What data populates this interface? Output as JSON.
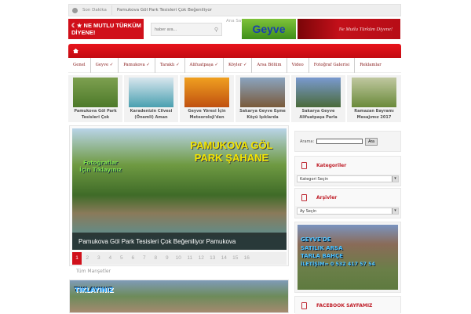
{
  "topbar": {
    "label": "Son Dakika",
    "news": "Pamukova Göl Park Tesisleri Çok Beğeniliyor"
  },
  "header": {
    "logo_text": "☾★ NE MUTLU TÜRKÜM DİYENE!",
    "search_placeholder": "haber ara...",
    "ana_sayfa": "Ana Sayfa",
    "ad_geyve": "Geyve",
    "ad_red": "Ne Mutlu Türküm Diyene!"
  },
  "nav": [
    "Genel",
    "Geyve ✓",
    "Pamukova ✓",
    "Taraklı ✓",
    "Alifuatpaşa ✓",
    "Köyler ✓",
    "Arsa Bölüm",
    "Video",
    "Fotoğraf Galerisi",
    "Reklamlar"
  ],
  "thumbs": [
    {
      "title": "Pamukova Göl Park Tesisleri Çok",
      "c1": "#7da050",
      "c2": "#4d7a2a"
    },
    {
      "title": "Karadenizin Cilvesi (Önemli) Aman",
      "c1": "#d8e6ee",
      "c2": "#4aa0b0"
    },
    {
      "title": "Geyve Yöresi İçin Meteoroloji'den",
      "c1": "#f0a020",
      "c2": "#c05010"
    },
    {
      "title": "Sakarya Geyve Eşme Köyü Işıklarda",
      "c1": "#8aa4c0",
      "c2": "#7a5a3a"
    },
    {
      "title": "Sakarya Geyve Alifuatpaşa Parla",
      "c1": "#7a9ad0",
      "c2": "#4a6a3a"
    },
    {
      "title": "Ramazan Bayramı Mesajımız 2017",
      "c1": "#c0c8a0",
      "c2": "#6a8a3a"
    }
  ],
  "slider": {
    "big": "PAMUKOVA GÖL PARK ŞAHANE",
    "small": "Fotoğraflar İçin Tıklayınız",
    "caption": "Pamukova Göl Park Tesisleri Çok Beğeniliyor Pamukova",
    "pages": [
      "1",
      "2",
      "3",
      "4",
      "5",
      "6",
      "7",
      "8",
      "9",
      "10",
      "11",
      "12",
      "13",
      "14",
      "15",
      "16"
    ],
    "active_page": 1,
    "all": "Tüm Manşetler"
  },
  "second_image": {
    "text": "TIKLAYINIZ"
  },
  "sidebar": {
    "search_label": "Arama:",
    "search_button": "Ara",
    "categories_title": "Kategoriler",
    "categories_select": "Kategori Seçin",
    "archives_title": "Arşivler",
    "archives_select": "Ay Seçin",
    "ad_lines": [
      "GEYVE'DE",
      "SATILIK ARSA",
      "TARLA BAHÇE",
      "İLETİŞİM= 0 532 417 57 54"
    ],
    "facebook_title": "FACEBOOK SAYFAMIZ"
  },
  "colors": {
    "accent": "#d0101a"
  }
}
